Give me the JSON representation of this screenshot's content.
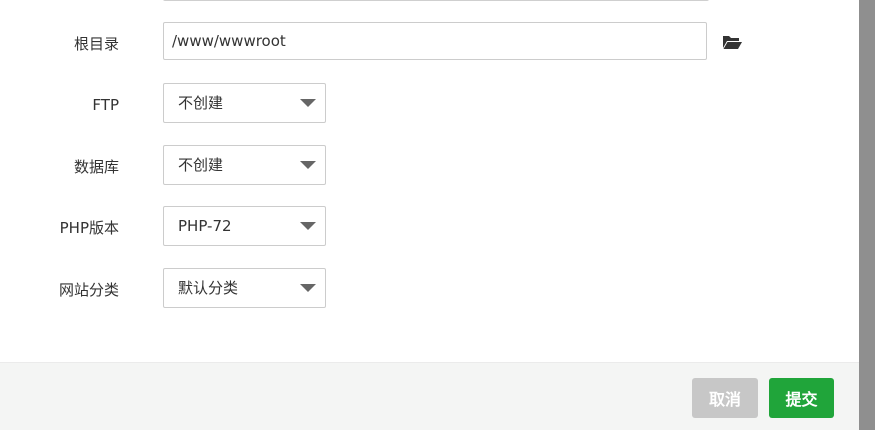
{
  "form": {
    "root_dir": {
      "label": "根目录",
      "value": "/www/wwwroot"
    },
    "ftp": {
      "label": "FTP",
      "selected": "不创建"
    },
    "database": {
      "label": "数据库",
      "selected": "不创建"
    },
    "php_version": {
      "label": "PHP版本",
      "selected": "PHP-72"
    },
    "site_category": {
      "label": "网站分类",
      "selected": "默认分类"
    }
  },
  "footer": {
    "cancel_label": "取消",
    "submit_label": "提交"
  },
  "colors": {
    "submit": "#20a53a",
    "cancel": "#c7c7c7",
    "footer_bg": "#f4f5f4",
    "scrollbar": "#8f8f8f"
  },
  "icons": {
    "folder": "folder-open-icon",
    "dropdown": "caret-down-icon"
  }
}
